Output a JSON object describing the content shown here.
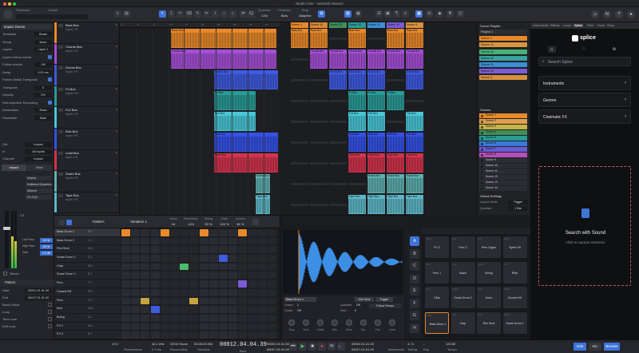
{
  "window": {
    "title": "Studio One - Seventh Heaven"
  },
  "toolbar": {
    "quantize_label": "Quantize",
    "quantize_value": "1/16",
    "timebase_label": "Timebase",
    "timebase_value": "Bars",
    "snap_label": "Snap",
    "snap_value": "Adaptive",
    "param_left": "Parameter",
    "param_right": "Control"
  },
  "inspector": {
    "track_name": "Impact Drums",
    "rows": [
      {
        "label": "Timebase",
        "value": "Beats"
      },
      {
        "label": "Group",
        "value": "None"
      },
      {
        "label": "Layers",
        "value": "Layer 1"
      },
      {
        "label": "Layers follow events",
        "value": ""
      },
      {
        "label": "Follow chords",
        "value": "Off"
      },
      {
        "label": "Delay",
        "value": "0.00 ms"
      },
      {
        "label": "Follow Global Transpose",
        "value": ""
      },
      {
        "label": "Transpose",
        "value": "0"
      },
      {
        "label": "Velocity",
        "value": "0%"
      },
      {
        "label": "Retrospective Recording",
        "value": ""
      },
      {
        "label": "Automation",
        "value": "Read"
      },
      {
        "label": "Parameter",
        "value": "Mute"
      }
    ],
    "io": [
      {
        "label": "Out",
        "value": "Impact"
      },
      {
        "label": "In",
        "value": "All Inputs"
      },
      {
        "label": "Channel",
        "value": "Impact"
      }
    ],
    "channels": [
      "Impact",
      "Main"
    ],
    "fx": [
      "Ampeq",
      "Multiband Dynamics",
      "Mixverb",
      "Pro EQ3"
    ],
    "filters": [
      {
        "label": "Low Pass",
        "value": "20 Hz"
      },
      {
        "label": "High Pass",
        "value": "20 Hz"
      },
      {
        "label": "Gain",
        "value": "0.0 dB"
      }
    ],
    "fader_value": "-7.2",
    "stereo": "Stereo",
    "pattern_label": "Pattern",
    "pattern_rows": [
      {
        "label": "Start",
        "value": "00001.01.01.00"
      },
      {
        "label": "End",
        "value": "00017.01.01.00"
      },
      {
        "label": "Bass Follow",
        "value": ""
      },
      {
        "label": "Loop",
        "value": ""
      },
      {
        "label": "Time Lock",
        "value": ""
      },
      {
        "label": "Edit Lock",
        "value": ""
      }
    ]
  },
  "tracks": [
    {
      "name": "Bass Box",
      "sub": "Input L+R",
      "color": "#e8892b"
    },
    {
      "name": "Chords Box",
      "sub": "Input L+R",
      "color": "#a54fd6"
    },
    {
      "name": "Drums Box",
      "sub": "Input L+R",
      "color": "#3f5be0"
    },
    {
      "name": "Fx Box",
      "sub": "Input L+R",
      "color": "#2a9b96"
    },
    {
      "name": "Fx2 Box",
      "sub": "Input L+R",
      "color": "#49c7d6"
    },
    {
      "name": "Kick Box",
      "sub": "Input L+R",
      "color": "#3552e6"
    },
    {
      "name": "Lead Box",
      "sub": "Input L+R",
      "color": "#d2344d"
    },
    {
      "name": "Snare Box",
      "sub": "Input L+R",
      "color": "#5fb0b0"
    },
    {
      "name": "Tape Box",
      "sub": "Input L+R",
      "color": "#5fb8c8"
    }
  ],
  "arrange_clips": [
    {
      "name": "Bass Box",
      "track": 0
    },
    {
      "name": "Chords Box",
      "track": 1
    },
    {
      "name": "Drums Box",
      "track": 2
    },
    {
      "name": "Fx Box",
      "track": 3
    },
    {
      "name": "Fx2 Box",
      "track": 4
    },
    {
      "name": "Kick Box",
      "track": 5
    },
    {
      "name": "Lead Box",
      "track": 6
    },
    {
      "name": "Snare Box",
      "track": 7
    },
    {
      "name": "Tape Box",
      "track": 8
    }
  ],
  "scene_columns": [
    "Scene 1",
    "Scene 14",
    "Scene 13",
    "Scene 12",
    "Scene 11",
    "Scene 10",
    "Scene 9"
  ],
  "scene_column_colors": [
    "#e8892b",
    "#d7893a",
    "#3f8f5a",
    "#2a9b96",
    "#3b8fd4",
    "#7b5bd6",
    "#d8913f"
  ],
  "scene_cells": [
    [
      "Bass Box",
      "Bass Box",
      "",
      "Bass Box",
      "",
      "Bass Box",
      "Bass Box"
    ],
    [
      "",
      "Chords Box",
      "Chords Box",
      "Chords Box",
      "Chords Box",
      "Chords Box",
      "Chords Box"
    ],
    [
      "",
      "",
      "Drums Box",
      "Drums Box",
      "Drums Box",
      "",
      "Drums Box"
    ],
    [
      "",
      "",
      "",
      "Fx Box",
      "Fx Box",
      "Fx Box",
      ""
    ],
    [
      "",
      "",
      "",
      "Fx2 Box",
      "Fx2 Box",
      "",
      "Fx2 Box"
    ],
    [
      "",
      "",
      "",
      "Kick Box",
      "Kick Box",
      "Kick Box",
      "Kick Box"
    ],
    [
      "",
      "",
      "",
      "Lead Box",
      "Lead Box",
      "Lead Box",
      "Lead Box"
    ],
    [
      "",
      "",
      "",
      "",
      "Snare Box",
      "Snare Box",
      "Snare Box"
    ],
    [
      "",
      "",
      "",
      "Tape Box",
      "Tape Box",
      "Tape Box",
      "Tape Box"
    ]
  ],
  "playlist": {
    "title": "Scene Playlist",
    "items": [
      {
        "label": "Playlist 1",
        "color": "#2c2d33"
      },
      {
        "label": "Scene 1",
        "color": "#e8892b"
      },
      {
        "label": "Scene 14",
        "color": "#d9963f"
      },
      {
        "label": "Scene 13",
        "color": "#44b378"
      },
      {
        "label": "Scene 12",
        "color": "#3ba2a0"
      },
      {
        "label": "Scene 11",
        "color": "#3b8fd4"
      },
      {
        "label": "Scene 10",
        "color": "#7b5bd6"
      },
      {
        "label": "Scene 9",
        "color": "#d8913f"
      }
    ],
    "scenes_title": "Scenes",
    "scenes": [
      {
        "label": "Scene 1",
        "color": "#e8892b"
      },
      {
        "label": "Scene 2",
        "color": "#e0a050"
      },
      {
        "label": "Scene 3",
        "color": "#c7b347"
      },
      {
        "label": "Scene 4",
        "color": "#3f8f5a"
      },
      {
        "label": "Scene 5",
        "color": "#2a9b96"
      },
      {
        "label": "Scene 6",
        "color": "#3b7bd4"
      },
      {
        "label": "Scene 7",
        "color": "#6a5bd6"
      },
      {
        "label": "Scene 8",
        "color": "#b44fb8"
      },
      {
        "label": "Scene 9",
        "color": "#2c2d33"
      },
      {
        "label": "Scene 10",
        "color": "#2c2d33"
      },
      {
        "label": "Scene 11",
        "color": "#2c2d33"
      },
      {
        "label": "Scene 12",
        "color": "#2c2d33"
      },
      {
        "label": "Scene 13",
        "color": "#2c2d33"
      },
      {
        "label": "Scene 14",
        "color": "#2c2d33"
      }
    ],
    "global_label": "Global Settings",
    "launch_label": "Launch Mode",
    "launch_value": "Trigger",
    "quantize_label": "Quantize",
    "quantize_value": "1 Bar"
  },
  "browser": {
    "tabs": [
      "Instruments",
      "Effects",
      "Loops",
      "Splice",
      "Files",
      "Cloud",
      "Shop"
    ],
    "active_tab": "Splice",
    "brand": "splice",
    "search_placeholder": "Search Splice",
    "categories": [
      "Instruments",
      "Genres",
      "Cinematic FX"
    ],
    "sound_title": "Search with Sound",
    "sound_sub": "click to capture selection"
  },
  "pattern": {
    "label": "Pattern",
    "variation": "Variation 1",
    "steps_label": "Steps",
    "steps_value": "16",
    "resolution_label": "Resolution",
    "resolution_value": "1/16",
    "swing_label": "Swing",
    "swing_value": "50 %",
    "gate_label": "Gate",
    "gate_value": "100 %",
    "accent_label": "Accent",
    "accent_value": "80 %",
    "instrument": "Impact",
    "rows": [
      {
        "name": "Bass Drum 1",
        "note": "B 0"
      },
      {
        "name": "Bass Drum 2",
        "note": "C 1"
      },
      {
        "name": "Rim Shot",
        "note": "C# 1"
      },
      {
        "name": "Snare Drum 1",
        "note": "D 1"
      },
      {
        "name": "Clap",
        "note": "D# 1"
      },
      {
        "name": "Snare Drum 2",
        "note": "E 1"
      },
      {
        "name": "Perc",
        "note": "F 1"
      },
      {
        "name": "Closed HH",
        "note": "F# 1"
      },
      {
        "name": "Perc",
        "note": "G 1"
      },
      {
        "name": "Kick",
        "note": "G# 1"
      },
      {
        "name": "Boing",
        "note": "A 1"
      },
      {
        "name": "FX 1",
        "note": "A# 1"
      },
      {
        "name": "FX 2",
        "note": "B 1"
      }
    ],
    "steps": [
      {
        "row": 0,
        "col": 0,
        "color": "#e8892b"
      },
      {
        "row": 0,
        "col": 4,
        "color": "#e8892b"
      },
      {
        "row": 0,
        "col": 8,
        "color": "#e8892b"
      },
      {
        "row": 0,
        "col": 12,
        "color": "#e8892b"
      },
      {
        "row": 3,
        "col": 10,
        "color": "#3f5be0"
      },
      {
        "row": 4,
        "col": 6,
        "color": "#4bbd6a"
      },
      {
        "row": 6,
        "col": 12,
        "color": "#7b5bd6"
      },
      {
        "row": 8,
        "col": 2,
        "color": "#c6a43f"
      },
      {
        "row": 8,
        "col": 7,
        "color": "#c6a43f"
      },
      {
        "row": 9,
        "col": 3,
        "color": "#3f5be0"
      }
    ]
  },
  "sampler": {
    "sample_name": "Minimal House",
    "pad_name": "Bass Drum 1",
    "output_label": "Output",
    "output_value": "1",
    "choke_label": "Choke",
    "choke_value": "Off",
    "quantize_label": "Quantize",
    "quantize_value": "Off",
    "mode_label": "One Shot",
    "trigger_label": "Trigger",
    "start_label": "Start",
    "start_value": "0",
    "knobs": [
      "Freq",
      "Tune",
      "Cutoff",
      "Res",
      "Drive",
      "Env",
      "Pan",
      "Level"
    ],
    "follow_label": "Follow Tempo"
  },
  "pads": {
    "bank_tabs": [
      "A",
      "B",
      "C",
      "D",
      "E",
      "F",
      "G",
      "H"
    ],
    "active_bank": "A",
    "rows": [
      [
        {
          "i": "D# 1",
          "l": "FX 2"
        },
        {
          "i": "E 1",
          "l": "Perc 2"
        },
        {
          "i": "F 1",
          "l": "Perc Organ"
        },
        {
          "i": "F# 1",
          "l": "Synth Hit"
        }
      ],
      [
        {
          "i": "B 0",
          "l": "Perc 1"
        },
        {
          "i": "C 1",
          "l": "Klack"
        },
        {
          "i": "C# 1",
          "l": "Boing"
        },
        {
          "i": "D 1",
          "l": "Ride"
        }
      ],
      [
        {
          "i": "G 0",
          "l": "Click"
        },
        {
          "i": "G# 0",
          "l": "Snare Drum 2"
        },
        {
          "i": "A 0",
          "l": "Guiro"
        },
        {
          "i": "A# 0",
          "l": "Closed HH"
        }
      ],
      [
        {
          "i": "D# 0",
          "l": "Bass Drum 1"
        },
        {
          "i": "E 0",
          "l": "Clap"
        },
        {
          "i": "F 0",
          "l": "Rim Shot"
        },
        {
          "i": "F# 0",
          "l": "Snare Drum 1"
        }
      ]
    ]
  },
  "transport": {
    "midi_label": "MIDI",
    "perf_label": "Performance",
    "samplerate": "44.1 kHz",
    "samplerate_sub": "0.9 ms",
    "record_time": "19:02 Hours",
    "record_sub": "Record Max",
    "seconds": "00:00:23.334",
    "seconds_sub": "Seconds",
    "bars": "00012.04.04.39",
    "bars_sub": "Bars",
    "loop_start": "00001.01.01.00",
    "loop_end": "00017.01.01.00",
    "time_sig": "4 / 4",
    "key": "-",
    "tempo": "120.00",
    "tempo_label": "Tempo",
    "metronome": "Metronome",
    "timing": "Timing",
    "key_label": "Key",
    "views": [
      "Edit",
      "Mix",
      "Browse"
    ]
  }
}
